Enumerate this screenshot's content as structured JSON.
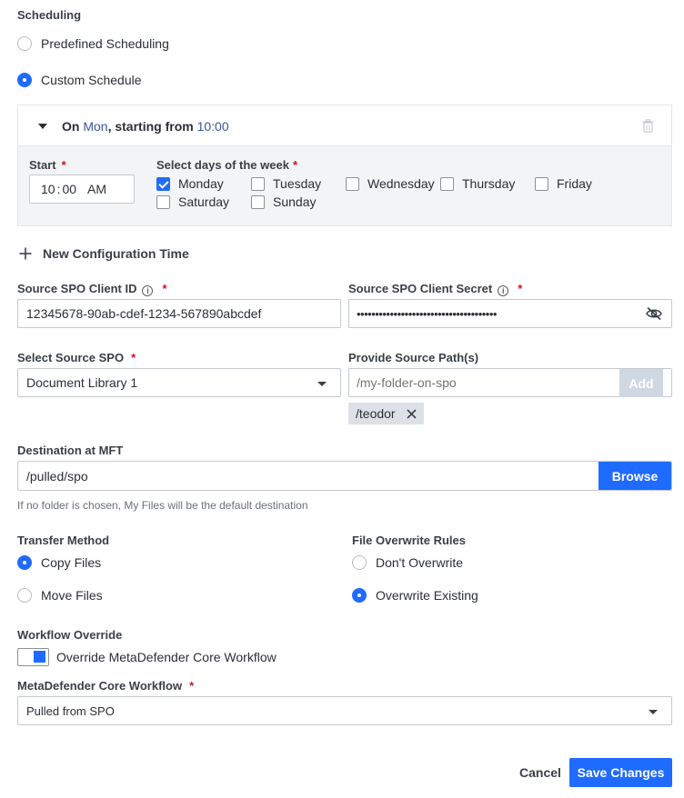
{
  "scheduling": {
    "label": "Scheduling",
    "options": [
      {
        "label": "Predefined Scheduling",
        "selected": false
      },
      {
        "label": "Custom Schedule",
        "selected": true
      }
    ],
    "config": {
      "summary_prefix": "On ",
      "summary_day": "Mon",
      "summary_mid": ", starting from ",
      "summary_time": "10:00",
      "start_label": "Start",
      "start_required": "*",
      "time": {
        "hour": "10",
        "sep": ":",
        "minute": "00",
        "ampm": "AM"
      },
      "days_label": "Select days of the week",
      "days_required": "*",
      "days": [
        {
          "label": "Monday",
          "checked": true
        },
        {
          "label": "Tuesday",
          "checked": false
        },
        {
          "label": "Wednesday",
          "checked": false
        },
        {
          "label": "Thursday",
          "checked": false
        },
        {
          "label": "Friday",
          "checked": false
        },
        {
          "label": "Saturday",
          "checked": false
        },
        {
          "label": "Sunday",
          "checked": false
        }
      ]
    },
    "new_config_label": "New Configuration Time"
  },
  "client_id": {
    "label": "Source SPO Client ID",
    "required": "*",
    "value": "12345678-90ab-cdef-1234-567890abcdef"
  },
  "client_secret": {
    "label": "Source SPO Client Secret",
    "required": "*",
    "value": "••••••••••••••••••••••••••••••••••••••"
  },
  "source_spo": {
    "label": "Select Source SPO",
    "required": "*",
    "value": "Document Library 1"
  },
  "source_path": {
    "label": "Provide Source Path(s)",
    "placeholder": "/my-folder-on-spo",
    "add_label": "Add",
    "tags": [
      "/teodor"
    ]
  },
  "destination": {
    "label": "Destination at MFT",
    "value": "/pulled/spo",
    "browse_label": "Browse",
    "hint": "If no folder is chosen, My Files will be the default destination"
  },
  "transfer_method": {
    "label": "Transfer Method",
    "options": [
      {
        "label": "Copy Files",
        "selected": true
      },
      {
        "label": "Move Files",
        "selected": false
      }
    ]
  },
  "overwrite_rules": {
    "label": "File Overwrite Rules",
    "options": [
      {
        "label": "Don't Overwrite",
        "selected": false
      },
      {
        "label": "Overwrite Existing",
        "selected": true
      }
    ]
  },
  "workflow_override": {
    "label": "Workflow Override",
    "toggle_label": "Override MetaDefender Core Workflow",
    "enabled": true
  },
  "core_workflow": {
    "label": "MetaDefender Core Workflow",
    "required": "*",
    "value": "Pulled from SPO"
  },
  "actions": {
    "cancel_label": "Cancel",
    "save_label": "Save Changes"
  },
  "colors": {
    "accent": "#1f6bff",
    "required": "#d4102a"
  }
}
